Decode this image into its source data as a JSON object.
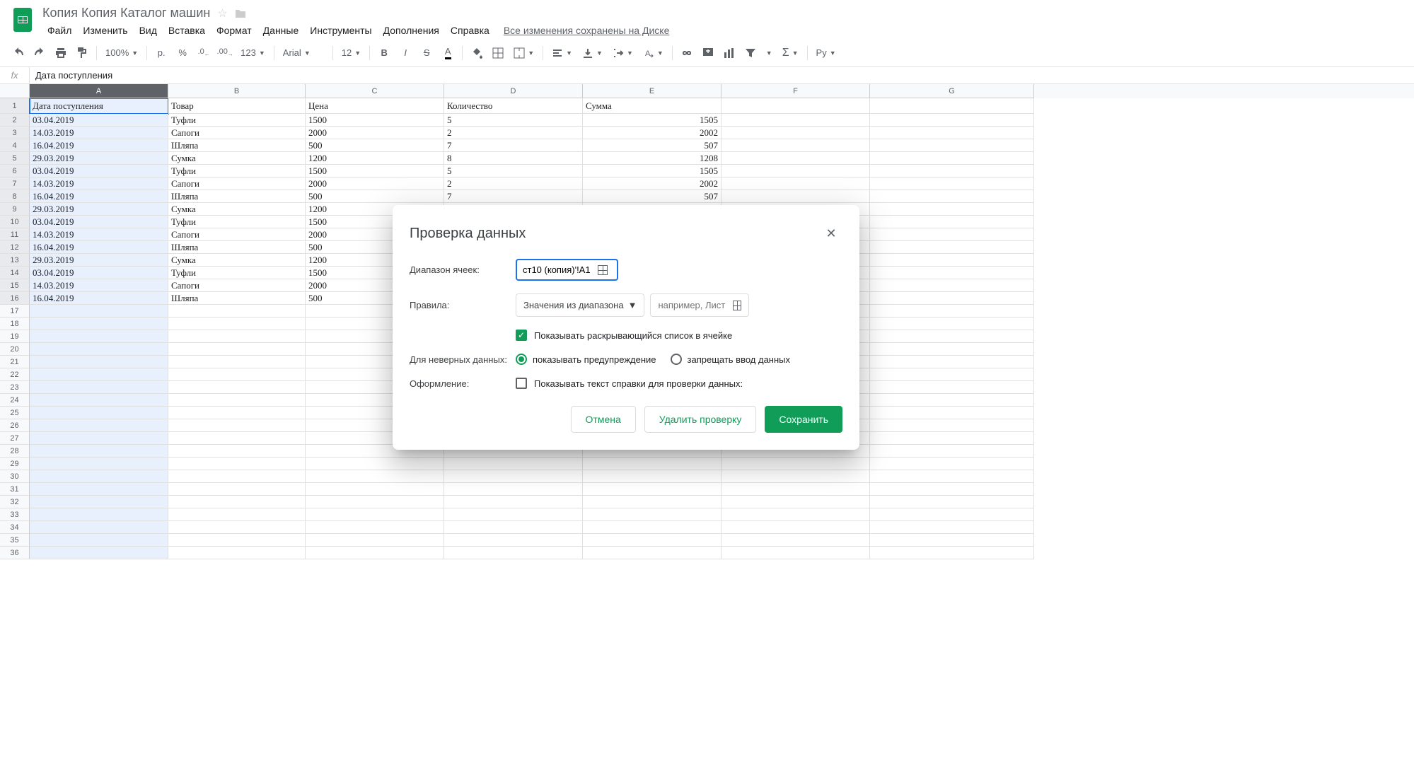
{
  "header": {
    "title": "Копия Копия Каталог машин"
  },
  "menu": {
    "file": "Файл",
    "edit": "Изменить",
    "view": "Вид",
    "insert": "Вставка",
    "format": "Формат",
    "data": "Данные",
    "tools": "Инструменты",
    "addons": "Дополнения",
    "help": "Справка",
    "drive_status": "Все изменения сохранены на Диске"
  },
  "toolbar": {
    "zoom": "100%",
    "currency": "р.",
    "percent": "%",
    "dec_minus": ".0",
    "dec_plus": ".00",
    "num_format": "123",
    "font": "Arial",
    "size": "12",
    "lang": "Ру"
  },
  "formula": {
    "fx": "fx",
    "value": "Дата поступления"
  },
  "columns": [
    "A",
    "B",
    "C",
    "D",
    "E",
    "F",
    "G"
  ],
  "table": {
    "headers": [
      "Дата поступления",
      "Товар",
      "Цена",
      "Количество",
      "Сумма"
    ],
    "rows": [
      [
        "03.04.2019",
        "Туфли",
        "1500",
        "5",
        "1505"
      ],
      [
        "14.03.2019",
        "Сапоги",
        "2000",
        "2",
        "2002"
      ],
      [
        "16.04.2019",
        "Шляпа",
        "500",
        "7",
        "507"
      ],
      [
        "29.03.2019",
        "Сумка",
        "1200",
        "8",
        "1208"
      ],
      [
        "03.04.2019",
        "Туфли",
        "1500",
        "5",
        "1505"
      ],
      [
        "14.03.2019",
        "Сапоги",
        "2000",
        "2",
        "2002"
      ],
      [
        "16.04.2019",
        "Шляпа",
        "500",
        "7",
        "507"
      ],
      [
        "29.03.2019",
        "Сумка",
        "1200",
        "",
        ""
      ],
      [
        "03.04.2019",
        "Туфли",
        "1500",
        "",
        ""
      ],
      [
        "14.03.2019",
        "Сапоги",
        "2000",
        "",
        ""
      ],
      [
        "16.04.2019",
        "Шляпа",
        "500",
        "",
        ""
      ],
      [
        "29.03.2019",
        "Сумка",
        "1200",
        "",
        ""
      ],
      [
        "03.04.2019",
        "Туфли",
        "1500",
        "",
        ""
      ],
      [
        "14.03.2019",
        "Сапоги",
        "2000",
        "",
        ""
      ],
      [
        "16.04.2019",
        "Шляпа",
        "500",
        "",
        ""
      ]
    ]
  },
  "dialog": {
    "title": "Проверка данных",
    "range_label": "Диапазон ячеек:",
    "range_value": "ст10 (копия)'!A1",
    "rules_label": "Правила:",
    "rules_select": "Значения из диапазона",
    "rules_placeholder": "например, Лист",
    "show_dropdown": "Показывать раскрывающийся список в ячейке",
    "invalid_label": "Для неверных данных:",
    "show_warning": "показывать предупреждение",
    "reject_input": "запрещать ввод данных",
    "appearance_label": "Оформление:",
    "show_help": "Показывать текст справки для проверки данных:",
    "cancel": "Отмена",
    "remove": "Удалить проверку",
    "save": "Сохранить"
  }
}
